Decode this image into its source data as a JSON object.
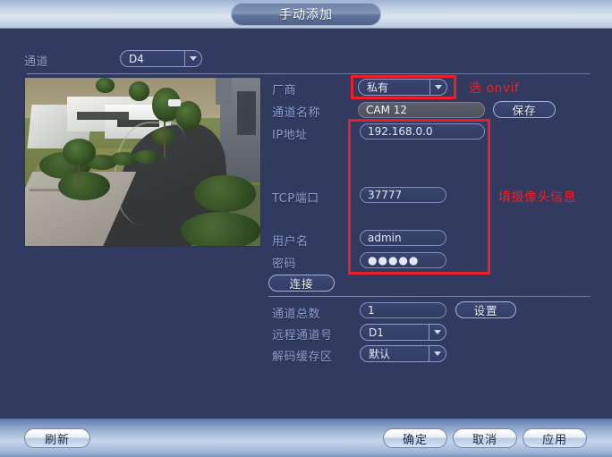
{
  "window": {
    "title": "手动添加"
  },
  "channel_row": {
    "label": "通道",
    "value": "D4"
  },
  "form": {
    "manufacturer": {
      "label": "厂商",
      "value": "私有"
    },
    "channel_name": {
      "label": "通道名称",
      "value": "CAM 12"
    },
    "ip_address": {
      "label": "IP地址",
      "value": "192.168.0.0"
    },
    "tcp_port": {
      "label": "TCP端口",
      "value": "37777"
    },
    "username": {
      "label": "用户名",
      "value": "admin"
    },
    "password": {
      "label": "密码",
      "value": "●●●●●"
    },
    "total_channels": {
      "label": "通道总数",
      "value": "1"
    },
    "remote_channel": {
      "label": "远程通道号",
      "value": "D1"
    },
    "decode_buffer": {
      "label": "解码缓存区",
      "value": "默认"
    }
  },
  "buttons": {
    "save": "保存",
    "connect": "连接",
    "setup": "设置",
    "refresh": "刷新",
    "ok": "确定",
    "cancel": "取消",
    "apply": "应用"
  },
  "annotations": {
    "onvif_hint": "选 onvif",
    "camera_info_hint": "填摄像头信息"
  },
  "colors": {
    "accent_red": "#e8202a",
    "label_blue": "#8f9ed6",
    "panel_bg": "#323b5f"
  }
}
